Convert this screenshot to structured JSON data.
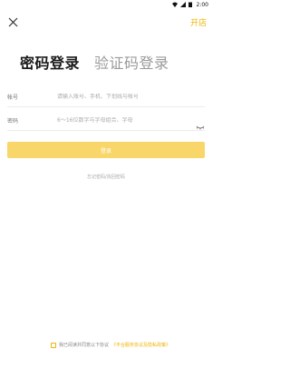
{
  "status_bar": {
    "time": "2:00"
  },
  "header": {
    "open_store": "开店"
  },
  "tabs": {
    "password_login": "密码登录",
    "code_login": "验证码登录"
  },
  "account": {
    "label": "帐号",
    "placeholder": "请输入账号、手机、下划线与帐号"
  },
  "password": {
    "label": "密码",
    "placeholder": "6～16位数字与字母组合、字母"
  },
  "login_button": "登录",
  "forgot_password": "忘记密码/找回密码",
  "agreement": {
    "text": "我已阅读并同意以下协议",
    "link": "《平台服务协议及隐私政策》"
  },
  "colors": {
    "accent": "#f0b400",
    "button_bg": "#f8d669"
  }
}
